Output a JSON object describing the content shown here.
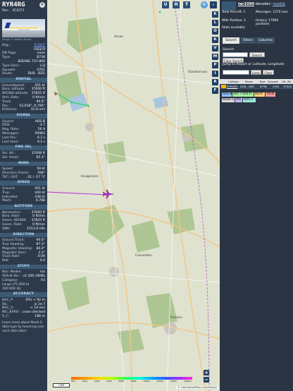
{
  "aircraft": {
    "callsign": "RYR4RG",
    "hex_label": "Hex: 4CA251",
    "photo_credit": "Image © Wesley Rauer",
    "close_label": "✕",
    "details": [
      {
        "k": "Reg.:",
        "v": "EI-DCE",
        "link": true
      },
      {
        "k": "",
        "v": "Ireland"
      },
      {
        "k": "DB flags:",
        "v": "none"
      },
      {
        "k": "Type:",
        "v": "B738"
      },
      {
        "k": "",
        "v": "BOEING 737-800"
      },
      {
        "k": "Type Desc.:",
        "v": "L2J"
      },
      {
        "k": "Squawk:",
        "v": "4761"
      },
      {
        "k": "Route:",
        "v": "DUB - BZG"
      }
    ]
  },
  "sections": {
    "spatial": {
      "title": "SPATIAL",
      "rows": [
        {
          "k": "Groundspeed:",
          "v": "451 kt"
        },
        {
          "k": "Baro. altitude:",
          "v": "37000 ft"
        },
        {
          "k": "WGS84 altitude:",
          "v": "37825 ft"
        },
        {
          "k": "Vert. Rate:",
          "v": "0 ft/min"
        },
        {
          "k": "Track:",
          "v": "94.6°"
        },
        {
          "k": "Pos.:",
          "v": "53.018°, 6.795°"
        },
        {
          "k": "Distance:",
          "v": "32.8 nmi"
        }
      ]
    },
    "signal": {
      "title": "SIGNAL",
      "rows": [
        {
          "k": "Source:",
          "v": "ADS-B"
        },
        {
          "k": "RSSI:",
          "v": "-3.7"
        },
        {
          "k": "Msg. Rate:",
          "v": "56.9"
        },
        {
          "k": "Messages:",
          "v": "59982"
        },
        {
          "k": "Last Pos.:",
          "v": "0.2 s"
        },
        {
          "k": "Last Seen:",
          "v": "0.2 s"
        }
      ]
    },
    "fms": {
      "title": "FMS SEL",
      "rows": [
        {
          "k": "Sel. Alt.:",
          "v": "37008 ft"
        },
        {
          "k": "Sel. Head.:",
          "v": "65.3°"
        }
      ]
    },
    "wind": {
      "title": "WIND",
      "rows": [
        {
          "k": "Speed:",
          "v": "59 kt"
        },
        {
          "k": "Direction (from):",
          "v": "358°"
        },
        {
          "k": "TAT / OAT:",
          "v": "-31 / -57 °C"
        }
      ]
    },
    "speed": {
      "title": "SPEED",
      "rows": [
        {
          "k": "Ground:",
          "v": "451 kt"
        },
        {
          "k": "True:",
          "v": "440 kt"
        },
        {
          "k": "Indicated:",
          "v": "248 kt"
        },
        {
          "k": "Mach:",
          "v": "0.788"
        }
      ]
    },
    "altitude": {
      "title": "ALTITUDE",
      "rows": [
        {
          "k": "Barometric:",
          "v": "37000 ft"
        },
        {
          "k": "Baro. Rate:",
          "v": "0 ft/min"
        },
        {
          "k": "Geom. WGS84:",
          "v": "37825 ft"
        },
        {
          "k": "Geom. Rate:",
          "v": "0 ft/min"
        },
        {
          "k": "QNH:",
          "v": "1013.6 hPa"
        }
      ]
    },
    "direction": {
      "title": "DIRECTION",
      "rows": [
        {
          "k": "Ground Track:",
          "v": "94.6°"
        },
        {
          "k": "True Heading:",
          "v": "87.3°"
        },
        {
          "k": "Magnetic Heading:",
          "v": "84.0°"
        },
        {
          "k": "Magnetic Decl.:",
          "v": "3.3°"
        },
        {
          "k": "Track Rate:",
          "v": "0.00"
        },
        {
          "k": "Roll:",
          "v": "0.0"
        }
      ]
    },
    "stuff": {
      "title": "STUFF",
      "rows": [
        {
          "k": "Nav. Modes:",
          "v": "n/a"
        },
        {
          "k": "ADS-B Ver.:",
          "v": "v2 (DO-260B)"
        },
        {
          "k": "Category:",
          "v": "A3"
        },
        {
          "k": "Large (75 000 to",
          "v": ""
        },
        {
          "k": "300 000 lb)",
          "v": ""
        }
      ]
    },
    "accuracy": {
      "title": "ACCURACY",
      "rows": [
        {
          "k": "NAC_P:",
          "v": "EPU < 92 m"
        },
        {
          "k": "SIL:",
          "v": "≤ 1e-7"
        },
        {
          "k": "NAC_V:",
          "v": "< 10 m/s"
        },
        {
          "k": "NIC_BARO:",
          "v": "cross-checked"
        },
        {
          "k": "R_C:",
          "v": "186 m"
        }
      ]
    },
    "footer": "Learn more about Mode S data type by hovering over each data label."
  },
  "map": {
    "top_buttons": [
      "U",
      "H",
      "T"
    ],
    "side_buttons": [
      "K",
      "L",
      "O",
      "K",
      "V",
      "M",
      "P",
      "I",
      "R",
      "F"
    ],
    "zoom_in": "+",
    "zoom_out": "−",
    "scale_label": "5 NM",
    "alt_labels": [
      "500",
      "1000",
      "2000",
      "4000",
      "6000",
      "8000",
      "10000",
      "20000",
      "30000",
      "40000+"
    ],
    "attribution": "© OpenStreetMap contributors",
    "place_labels": [
      "Assen",
      "Emmen",
      "Coevorden",
      "Stadskanaal",
      "Hoogeveen"
    ]
  },
  "sidebar": {
    "brand_name": "tar1090",
    "brand_middle": " decoder: ",
    "brand_link": "readsb",
    "stats": {
      "total_label": "Total Aircraft: 1",
      "with_pos_label": "With Position: 1",
      "stats_label": "Stats available",
      "messages_label": "Messages: 1270 /sec",
      "history_label": "History: 17060 positions"
    },
    "tabs": [
      "Search",
      "Filters",
      "Columns"
    ],
    "search_label": "Search:",
    "search_button": "Search",
    "clear_search_button": "Clear Search",
    "jump_label": "Jump to Airport or Latitude, Longitude:",
    "jump_button": "Jump",
    "clear_button": "Clear",
    "table_headers": [
      "Callsign",
      "Route",
      "Type",
      "Squawk",
      "Alt. (ft)"
    ],
    "table_rows": [
      {
        "callsign": "RYR4RG",
        "route": "DUB - BZG",
        "type": "B738",
        "squawk": "4761",
        "alt": "37000"
      }
    ],
    "legend": [
      {
        "label": "ADS-B",
        "color": "#8fc3ff"
      },
      {
        "label": "UAT / ADS-R",
        "color": "#a3f0a3"
      },
      {
        "label": "MLAT",
        "color": "#ffd27a"
      },
      {
        "label": "TIS-B",
        "color": "#ff9c9c"
      },
      {
        "label": "Mode-S",
        "color": "#d8d8d8"
      },
      {
        "label": "AIS",
        "color": "#c6b4ff"
      },
      {
        "label": "ADS-C",
        "color": "#9ee6dc"
      }
    ]
  },
  "colors": {
    "map_bg": "#d8dcc8",
    "aircraft": "#b82bd6",
    "track_green": "#2bd36b",
    "track_red": "#e23b3b"
  }
}
